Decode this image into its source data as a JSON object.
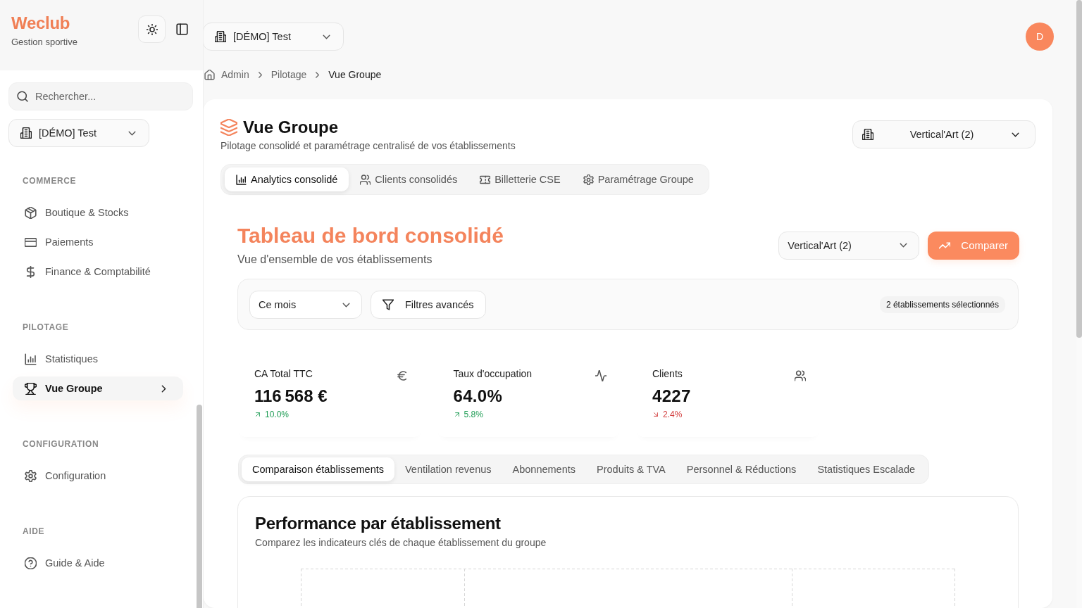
{
  "sidebar": {
    "brand": {
      "name": "Weclub",
      "tagline": "Gestion sportive"
    },
    "search": {
      "placeholder": "Rechercher..."
    },
    "workspace_select": {
      "value": "[DÉMO] Test"
    },
    "sections": [
      {
        "title": "COMMERCE",
        "items": [
          {
            "label": "Boutique & Stocks",
            "selected": false
          },
          {
            "label": "Paiements",
            "selected": false
          },
          {
            "label": "Finance & Comptabilité",
            "selected": false
          }
        ]
      },
      {
        "title": "PILOTAGE",
        "items": [
          {
            "label": "Statistiques",
            "selected": false
          },
          {
            "label": "Vue Groupe",
            "selected": true
          }
        ]
      },
      {
        "title": "CONFIGURATION",
        "items": [
          {
            "label": "Configuration",
            "selected": false
          }
        ]
      },
      {
        "title": "AIDE",
        "items": [
          {
            "label": "Guide & Aide",
            "selected": false
          }
        ]
      }
    ]
  },
  "header": {
    "workspace_select": {
      "value": "[DÉMO] Test"
    },
    "avatar": {
      "initial": "D"
    }
  },
  "breadcrumb": [
    {
      "label": "Admin",
      "current": false
    },
    {
      "label": "Pilotage",
      "current": false
    },
    {
      "label": "Vue Groupe",
      "current": true
    }
  ],
  "page": {
    "title": "Vue Groupe",
    "subtitle": "Pilotage consolidé et paramétrage centralisé de vos établissements",
    "group_select": {
      "value": "Vertical'Art (2)"
    },
    "tabs": [
      {
        "label": "Analytics consolidé",
        "selected": true
      },
      {
        "label": "Clients consolidés",
        "selected": false
      },
      {
        "label": "Billetterie CSE",
        "selected": false
      },
      {
        "label": "Paramétrage Groupe",
        "selected": false
      }
    ]
  },
  "dashboard": {
    "title": "Tableau de bord consolidé",
    "subtitle": "Vue d'ensemble de vos établissements",
    "group_select": {
      "value": "Vertical'Art (2)"
    },
    "compare_button": "Comparer",
    "filters": {
      "period_select": {
        "value": "Ce mois"
      },
      "advanced_button": "Filtres avancés",
      "selection_badge": "2 établissements sélectionnés"
    },
    "kpis": [
      {
        "label": "CA Total TTC",
        "value": "116 568 €",
        "change": "10.0%",
        "increase": true
      },
      {
        "label": "Taux d'occupation",
        "value": "64.0%",
        "change": "5.8%",
        "increase": true
      },
      {
        "label": "Clients",
        "value": "4227",
        "change": "2.4%",
        "increase": false
      }
    ],
    "sub_tabs": [
      {
        "label": "Comparaison établissements",
        "selected": true
      },
      {
        "label": "Ventilation revenus",
        "selected": false
      },
      {
        "label": "Abonnements",
        "selected": false
      },
      {
        "label": "Produits & TVA",
        "selected": false
      },
      {
        "label": "Personnel & Réductions",
        "selected": false
      },
      {
        "label": "Statistiques Escalade",
        "selected": false
      }
    ],
    "performance": {
      "title": "Performance par établissement",
      "subtitle": "Comparez les indicateurs clés de chaque établissement du groupe"
    }
  }
}
